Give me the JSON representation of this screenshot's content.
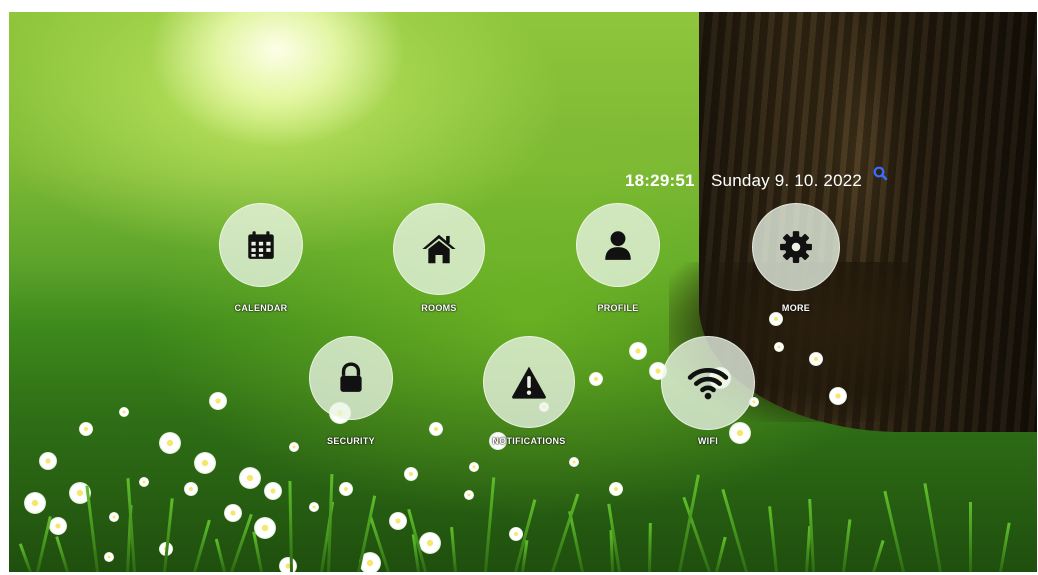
{
  "clock": {
    "time": "18:29:51",
    "date": "Sunday 9. 10. 2022"
  },
  "search": {
    "icon": "search-icon",
    "color": "#3b6cff"
  },
  "tiles": [
    {
      "id": "calendar",
      "label": "CALENDAR",
      "icon": "calendar-icon"
    },
    {
      "id": "rooms",
      "label": "ROOMS",
      "icon": "home-icon"
    },
    {
      "id": "profile",
      "label": "PROFILE",
      "icon": "user-icon"
    },
    {
      "id": "more",
      "label": "MORE",
      "icon": "gear-icon"
    },
    {
      "id": "security",
      "label": "SECURITY",
      "icon": "lock-icon"
    },
    {
      "id": "notifications",
      "label": "NOTIFICATIONS",
      "icon": "warning-icon"
    },
    {
      "id": "wifi",
      "label": "WIFI",
      "icon": "wifi-icon"
    }
  ],
  "colors": {
    "icon": "#111111",
    "tile_fill": "rgba(235,245,230,0.78)",
    "text": "#ffffff"
  }
}
